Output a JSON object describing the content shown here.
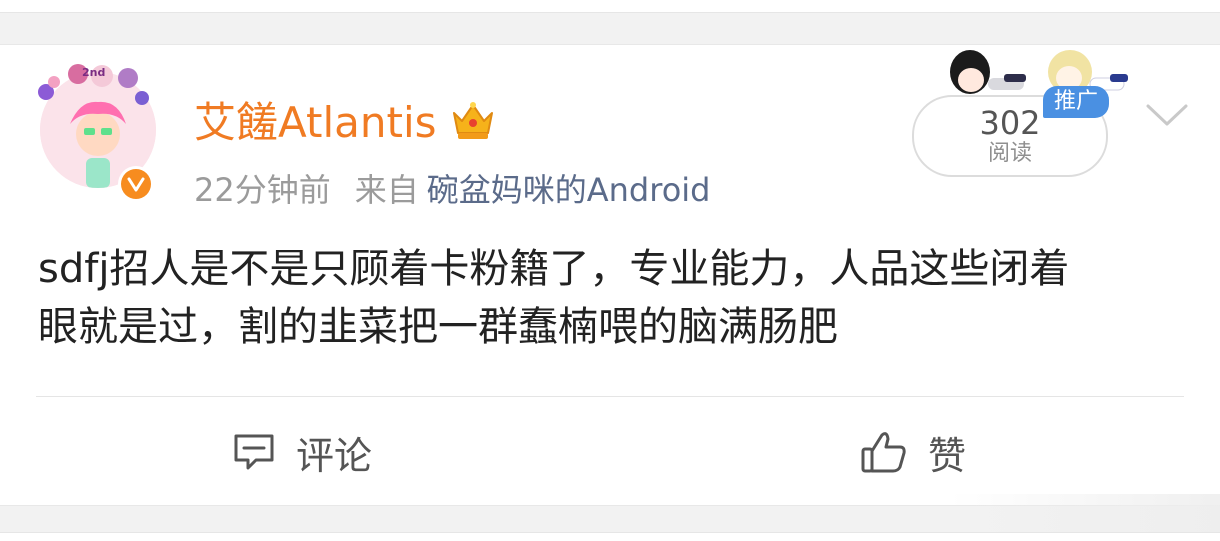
{
  "post": {
    "username": "艾饈Atlantis",
    "time": "22分钟前",
    "from_label": "来自",
    "source": "碗盆妈咪的Android",
    "reads": {
      "count": "302",
      "label": "阅读",
      "promo": "推广"
    },
    "content_lines": [
      "sdfj招人是不是只顾着卡粉籍了，专业能力，人品这些闭着",
      "眼就是过，割的韭菜把一群蠢楠喂的脑满肠肥"
    ]
  },
  "actions": {
    "comment": "评论",
    "like": "赞"
  },
  "icons": {
    "avatar": "avatar",
    "verified": "verified-badge-icon",
    "crown": "crown-icon",
    "chevron": "chevron-down-icon",
    "comment": "comment-icon",
    "like": "thumbs-up-icon"
  },
  "colors": {
    "username": "#f07b23",
    "source": "#5b6b8a",
    "promo_tag": "#4a90e2",
    "verified": "#f78c1f"
  }
}
